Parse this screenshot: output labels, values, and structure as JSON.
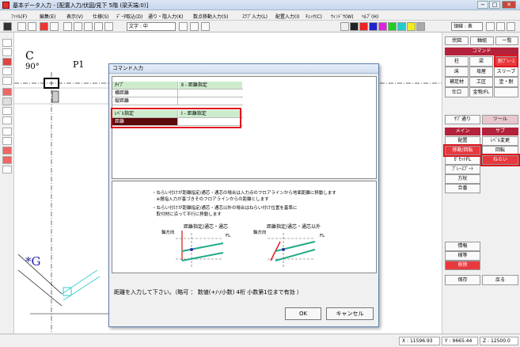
{
  "window": {
    "title": "基本データ入力 - [配置入力/伏図/見下 5階 (梁天端:0)]",
    "min": "−",
    "max": "□",
    "close": "✕"
  },
  "menu": [
    "ﾌｧｲﾙ(F)",
    "編集(E)",
    "表示(V)",
    "仕様(S)",
    "ﾃﾞｰﾀ取込(D)",
    "通り・階入力(K)",
    "数点移動入力(S)",
    "ｽﾗﾌﾞ入力(L)",
    "配置入力(I)",
    "ﾁｪｯｸ(C)",
    "ｳｨﾝﾄﾞｳ(W)",
    "ﾍﾙﾌﾟ(H)"
  ],
  "toolbar": {
    "char_combo": "文字 : 中",
    "scale_combo": "領線 : 表"
  },
  "canvas": {
    "grid_label": "C",
    "angle": "90°",
    "p_label": "P1",
    "g_label": "*G"
  },
  "right": {
    "top_buttons": [
      "伏図",
      "軸組",
      "一覧"
    ],
    "command_header": "コマンド",
    "cmd_rows": [
      [
        "柱",
        "梁",
        "耐ﾌﾞﾚｰｽ"
      ],
      [
        "床",
        "母屋",
        "スリーブ"
      ],
      [
        "補足材",
        "工区",
        "塗・耐"
      ],
      [
        "仕口",
        "金物/FL",
        ""
      ]
    ],
    "sabu_label": "ｻﾌﾞ通り",
    "tool_label": "ツール",
    "main_header": "メイン",
    "sub_header": "サブ",
    "main_items": [
      "配置",
      "移動/回転",
      "ｶﾞｾｯﾄFL",
      "ﾌﾟﾚｰｽﾌﾟｰﾄ",
      "方杖",
      "合番"
    ],
    "sub_items": [
      "ﾚﾍﾞﾙ変更",
      "回転",
      "ねらい"
    ],
    "bottom_items": [
      "情報",
      "様等",
      "削除"
    ],
    "save": "保存",
    "back": "戻る"
  },
  "dialog": {
    "title": "コマンド入力",
    "rows": [
      {
        "label": "ﾀｲﾌﾟ",
        "value": "Ⅱ - 距離指定"
      },
      {
        "label": "横距離",
        "value": ""
      },
      {
        "label": "縦距離",
        "value": ""
      },
      {
        "label": "ﾚﾍﾞﾙ指定",
        "value": "Ⅰ - 距離指定"
      },
      {
        "label": "距離",
        "value": ""
      }
    ],
    "notes": [
      "・ねらい付けが距離指定/通芯・通芯の場合は入力点のフロアラインから地面距離に移動します",
      "　※層指入力が基づきそのフロアラインからの距離とします",
      "・ねらい付けが距離指定/通芯・通芯以外の場合はねらい付け位置を基準に",
      "　取付材に沿って平行に移動します"
    ],
    "diagram1_title": "距離指定/通芯・通芯",
    "diagram2_title": "距離指定/通芯・通芯以外",
    "axis_label": "軸方向",
    "fl_label": "FL",
    "prompt": "距離を入力して下さい。（略可 ： 数値(+/-/小数) 4桁 小数第1位まで有効 ）",
    "ok": "OK",
    "cancel": "キャンセル"
  },
  "status": {
    "x": "X : 11596.93",
    "y": "Y : 9665.44",
    "z": "Z : 12500.0"
  }
}
